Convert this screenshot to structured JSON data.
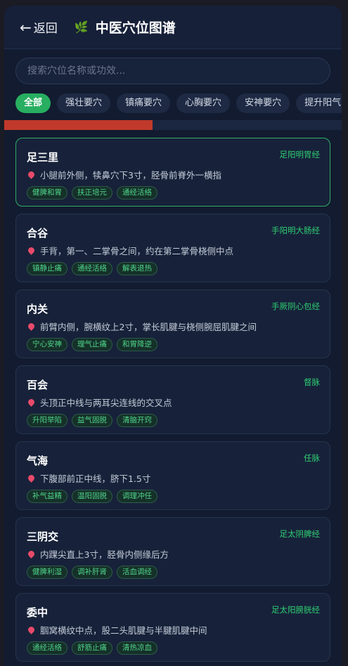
{
  "header": {
    "back_label": "返回",
    "title": "中医穴位图谱",
    "leaf_icon": "🌿"
  },
  "search": {
    "placeholder": "搜索穴位名称或功效..."
  },
  "filters": [
    "全部",
    "强壮要穴",
    "镇痛要穴",
    "心胸要穴",
    "安神要穴",
    "提升阳气"
  ],
  "progress": {
    "fraction": 0.44
  },
  "points": [
    {
      "name": "足三里",
      "meridian": "足阳明胃经",
      "location": "小腿前外侧，犊鼻穴下3寸，胫骨前脊外一横指",
      "tags": [
        "健脾和胃",
        "扶正培元",
        "通经活络"
      ]
    },
    {
      "name": "合谷",
      "meridian": "手阳明大肠经",
      "location": "手背，第一、二掌骨之间，约在第二掌骨桡侧中点",
      "tags": [
        "镇静止痛",
        "通经活络",
        "解表退热"
      ]
    },
    {
      "name": "内关",
      "meridian": "手厥阴心包经",
      "location": "前臂内侧，腕横纹上2寸，掌长肌腱与桡侧腕屈肌腱之间",
      "tags": [
        "宁心安神",
        "理气止痛",
        "和胃降逆"
      ]
    },
    {
      "name": "百会",
      "meridian": "督脉",
      "location": "头顶正中线与两耳尖连线的交叉点",
      "tags": [
        "升阳举陷",
        "益气固脱",
        "清脑开窍"
      ]
    },
    {
      "name": "气海",
      "meridian": "任脉",
      "location": "下腹部前正中线，脐下1.5寸",
      "tags": [
        "补气益精",
        "温阳固脱",
        "调理冲任"
      ]
    },
    {
      "name": "三阴交",
      "meridian": "足太阴脾经",
      "location": "内踝尖直上3寸，胫骨内侧缘后方",
      "tags": [
        "健脾利湿",
        "调补肝肾",
        "活血调经"
      ]
    },
    {
      "name": "委中",
      "meridian": "足太阳膀胱经",
      "location": "腘窝横纹中点，股二头肌腱与半腱肌腱中间",
      "tags": [
        "通经活络",
        "舒筋止痛",
        "清热凉血"
      ]
    }
  ]
}
